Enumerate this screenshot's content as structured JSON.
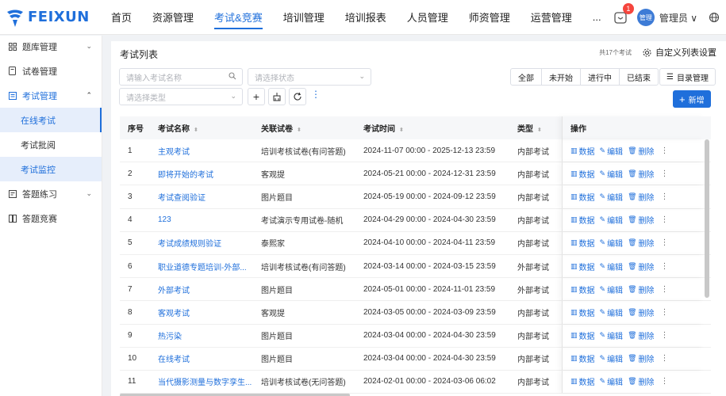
{
  "brand": {
    "name": "FEIXUN"
  },
  "nav": [
    "首页",
    "资源管理",
    "考试&竞赛",
    "培训管理",
    "培训报表",
    "人员管理",
    "师资管理",
    "运营管理",
    "..."
  ],
  "user": {
    "notice_count": "1",
    "avatar_text": "管理",
    "name": "管理员"
  },
  "sidebar": {
    "items": [
      {
        "label": "题库管理",
        "icon": "grid-icon"
      },
      {
        "label": "试卷管理",
        "icon": "paper-icon"
      },
      {
        "label": "考试管理",
        "icon": "exam-icon"
      },
      {
        "label": "答题练习",
        "icon": "practice-icon"
      },
      {
        "label": "答题竞赛",
        "icon": "contest-icon"
      }
    ],
    "sub": [
      "在线考试",
      "考试批阅",
      "考试监控"
    ]
  },
  "page": {
    "title": "考试列表",
    "total": "共17个考试",
    "custom_label": "自定义列表设置",
    "search_placeholder": "请输入考试名称",
    "status_placeholder": "请选择状态",
    "type_placeholder": "请选择类型",
    "seg": [
      "全部",
      "未开始",
      "进行中",
      "已结束"
    ],
    "dir_label": "目录管理",
    "add_label": "新增"
  },
  "table": {
    "headers": [
      "序号",
      "考试名称",
      "关联试卷",
      "考试时间",
      "类型",
      "操作"
    ],
    "ops": [
      "数据",
      "编辑",
      "删除"
    ],
    "rows": [
      {
        "idx": "1",
        "name": "主观考试",
        "paper": "培训考核试卷(有问答题)",
        "time": "2024-11-07 00:00 - 2025-12-13 23:59",
        "type": "内部考试"
      },
      {
        "idx": "2",
        "name": "即将开始的考试",
        "paper": "客观提",
        "time": "2024-05-21 00:00 - 2024-12-31 23:59",
        "type": "内部考试"
      },
      {
        "idx": "3",
        "name": "考试查阅验证",
        "paper": "图片题目",
        "time": "2024-05-19 00:00 - 2024-09-12 23:59",
        "type": "内部考试"
      },
      {
        "idx": "4",
        "name": "123",
        "paper": "考试演示专用试卷-随机",
        "time": "2024-04-29 00:00 - 2024-04-30 23:59",
        "type": "内部考试"
      },
      {
        "idx": "5",
        "name": "考试成绩规则验证",
        "paper": "泰熙家",
        "time": "2024-04-10 00:00 - 2024-04-11 23:59",
        "type": "内部考试"
      },
      {
        "idx": "6",
        "name": "职业道德专题培训-外部...",
        "paper": "培训考核试卷(有问答题)",
        "time": "2024-03-14 00:00 - 2024-03-15 23:59",
        "type": "外部考试"
      },
      {
        "idx": "7",
        "name": "外部考试",
        "paper": "图片题目",
        "time": "2024-05-01 00:00 - 2024-11-01 23:59",
        "type": "外部考试"
      },
      {
        "idx": "8",
        "name": "客观考试",
        "paper": "客观提",
        "time": "2024-03-05 00:00 - 2024-03-09 23:59",
        "type": "内部考试"
      },
      {
        "idx": "9",
        "name": "热污染",
        "paper": "图片题目",
        "time": "2024-03-04 00:00 - 2024-04-30 23:59",
        "type": "内部考试"
      },
      {
        "idx": "10",
        "name": "在线考试",
        "paper": "图片题目",
        "time": "2024-03-04 00:00 - 2024-04-30 23:59",
        "type": "内部考试"
      },
      {
        "idx": "11",
        "name": "当代摄影测量与数字孪生...",
        "paper": "培训考核试卷(无问答题)",
        "time": "2024-02-01 00:00 - 2024-03-06 06:02",
        "type": "内部考试"
      }
    ]
  },
  "colors": {
    "accent": "#1f6fdb",
    "badge": "#f5453d"
  }
}
